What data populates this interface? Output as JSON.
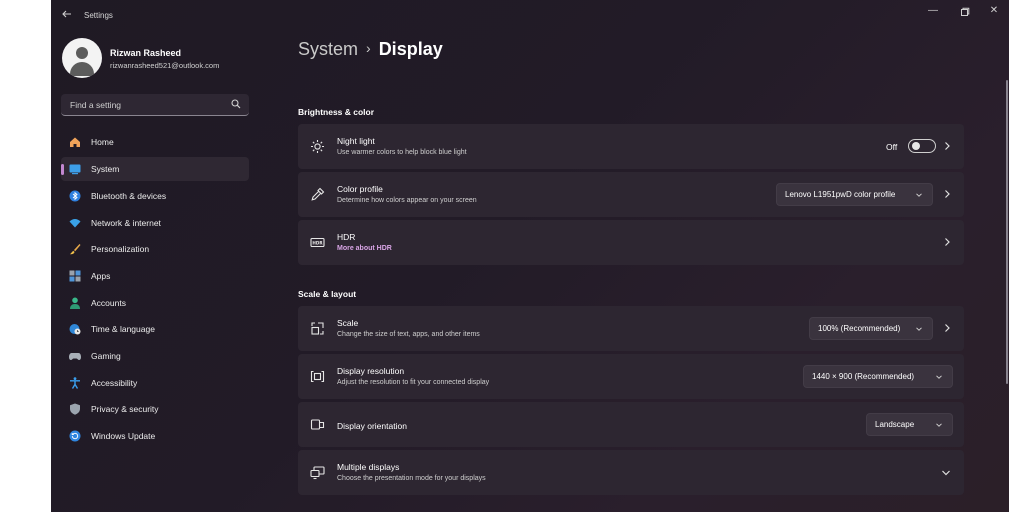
{
  "window": {
    "title": "Settings",
    "controls": {
      "minimize": "—",
      "maximize": "▢",
      "close": "✕"
    }
  },
  "profile": {
    "name": "Rizwan Rasheed",
    "email": "rizwanrasheed521@outlook.com"
  },
  "search": {
    "placeholder": "Find a setting"
  },
  "sidebar": {
    "items": [
      {
        "label": "Home",
        "icon": "home-icon",
        "active": false
      },
      {
        "label": "System",
        "icon": "monitor-icon",
        "active": true
      },
      {
        "label": "Bluetooth & devices",
        "icon": "bluetooth-icon",
        "active": false
      },
      {
        "label": "Network & internet",
        "icon": "wifi-icon",
        "active": false
      },
      {
        "label": "Personalization",
        "icon": "brush-icon",
        "active": false
      },
      {
        "label": "Apps",
        "icon": "apps-icon",
        "active": false
      },
      {
        "label": "Accounts",
        "icon": "person-icon",
        "active": false
      },
      {
        "label": "Time & language",
        "icon": "globe-clock-icon",
        "active": false
      },
      {
        "label": "Gaming",
        "icon": "gamepad-icon",
        "active": false
      },
      {
        "label": "Accessibility",
        "icon": "accessibility-icon",
        "active": false
      },
      {
        "label": "Privacy & security",
        "icon": "shield-icon",
        "active": false
      },
      {
        "label": "Windows Update",
        "icon": "update-icon",
        "active": false
      }
    ]
  },
  "main": {
    "breadcrumb": {
      "parent": "System",
      "separator": "›",
      "current": "Display"
    },
    "sections": [
      {
        "title": "Brightness & color",
        "cards": [
          {
            "title": "Night light",
            "subtitle": "Use warmer colors to help block blue light",
            "toggle_label": "Off",
            "toggle_on": false
          },
          {
            "title": "Color profile",
            "subtitle": "Determine how colors appear on your screen",
            "dropdown": "Lenovo L1951pwD color profile"
          },
          {
            "title": "HDR",
            "link": "More about HDR"
          }
        ]
      },
      {
        "title": "Scale & layout",
        "cards": [
          {
            "title": "Scale",
            "subtitle": "Change the size of text, apps, and other items",
            "dropdown": "100% (Recommended)"
          },
          {
            "title": "Display resolution",
            "subtitle": "Adjust the resolution to fit your connected display",
            "dropdown": "1440 × 900 (Recommended)"
          },
          {
            "title": "Display orientation",
            "dropdown": "Landscape"
          },
          {
            "title": "Multiple displays",
            "subtitle": "Choose the presentation mode for your displays"
          }
        ]
      }
    ]
  },
  "colors": {
    "accent": "#c287d0",
    "link": "#d9a5e6",
    "card": "#2d2631",
    "window_bg": "#221b27"
  }
}
